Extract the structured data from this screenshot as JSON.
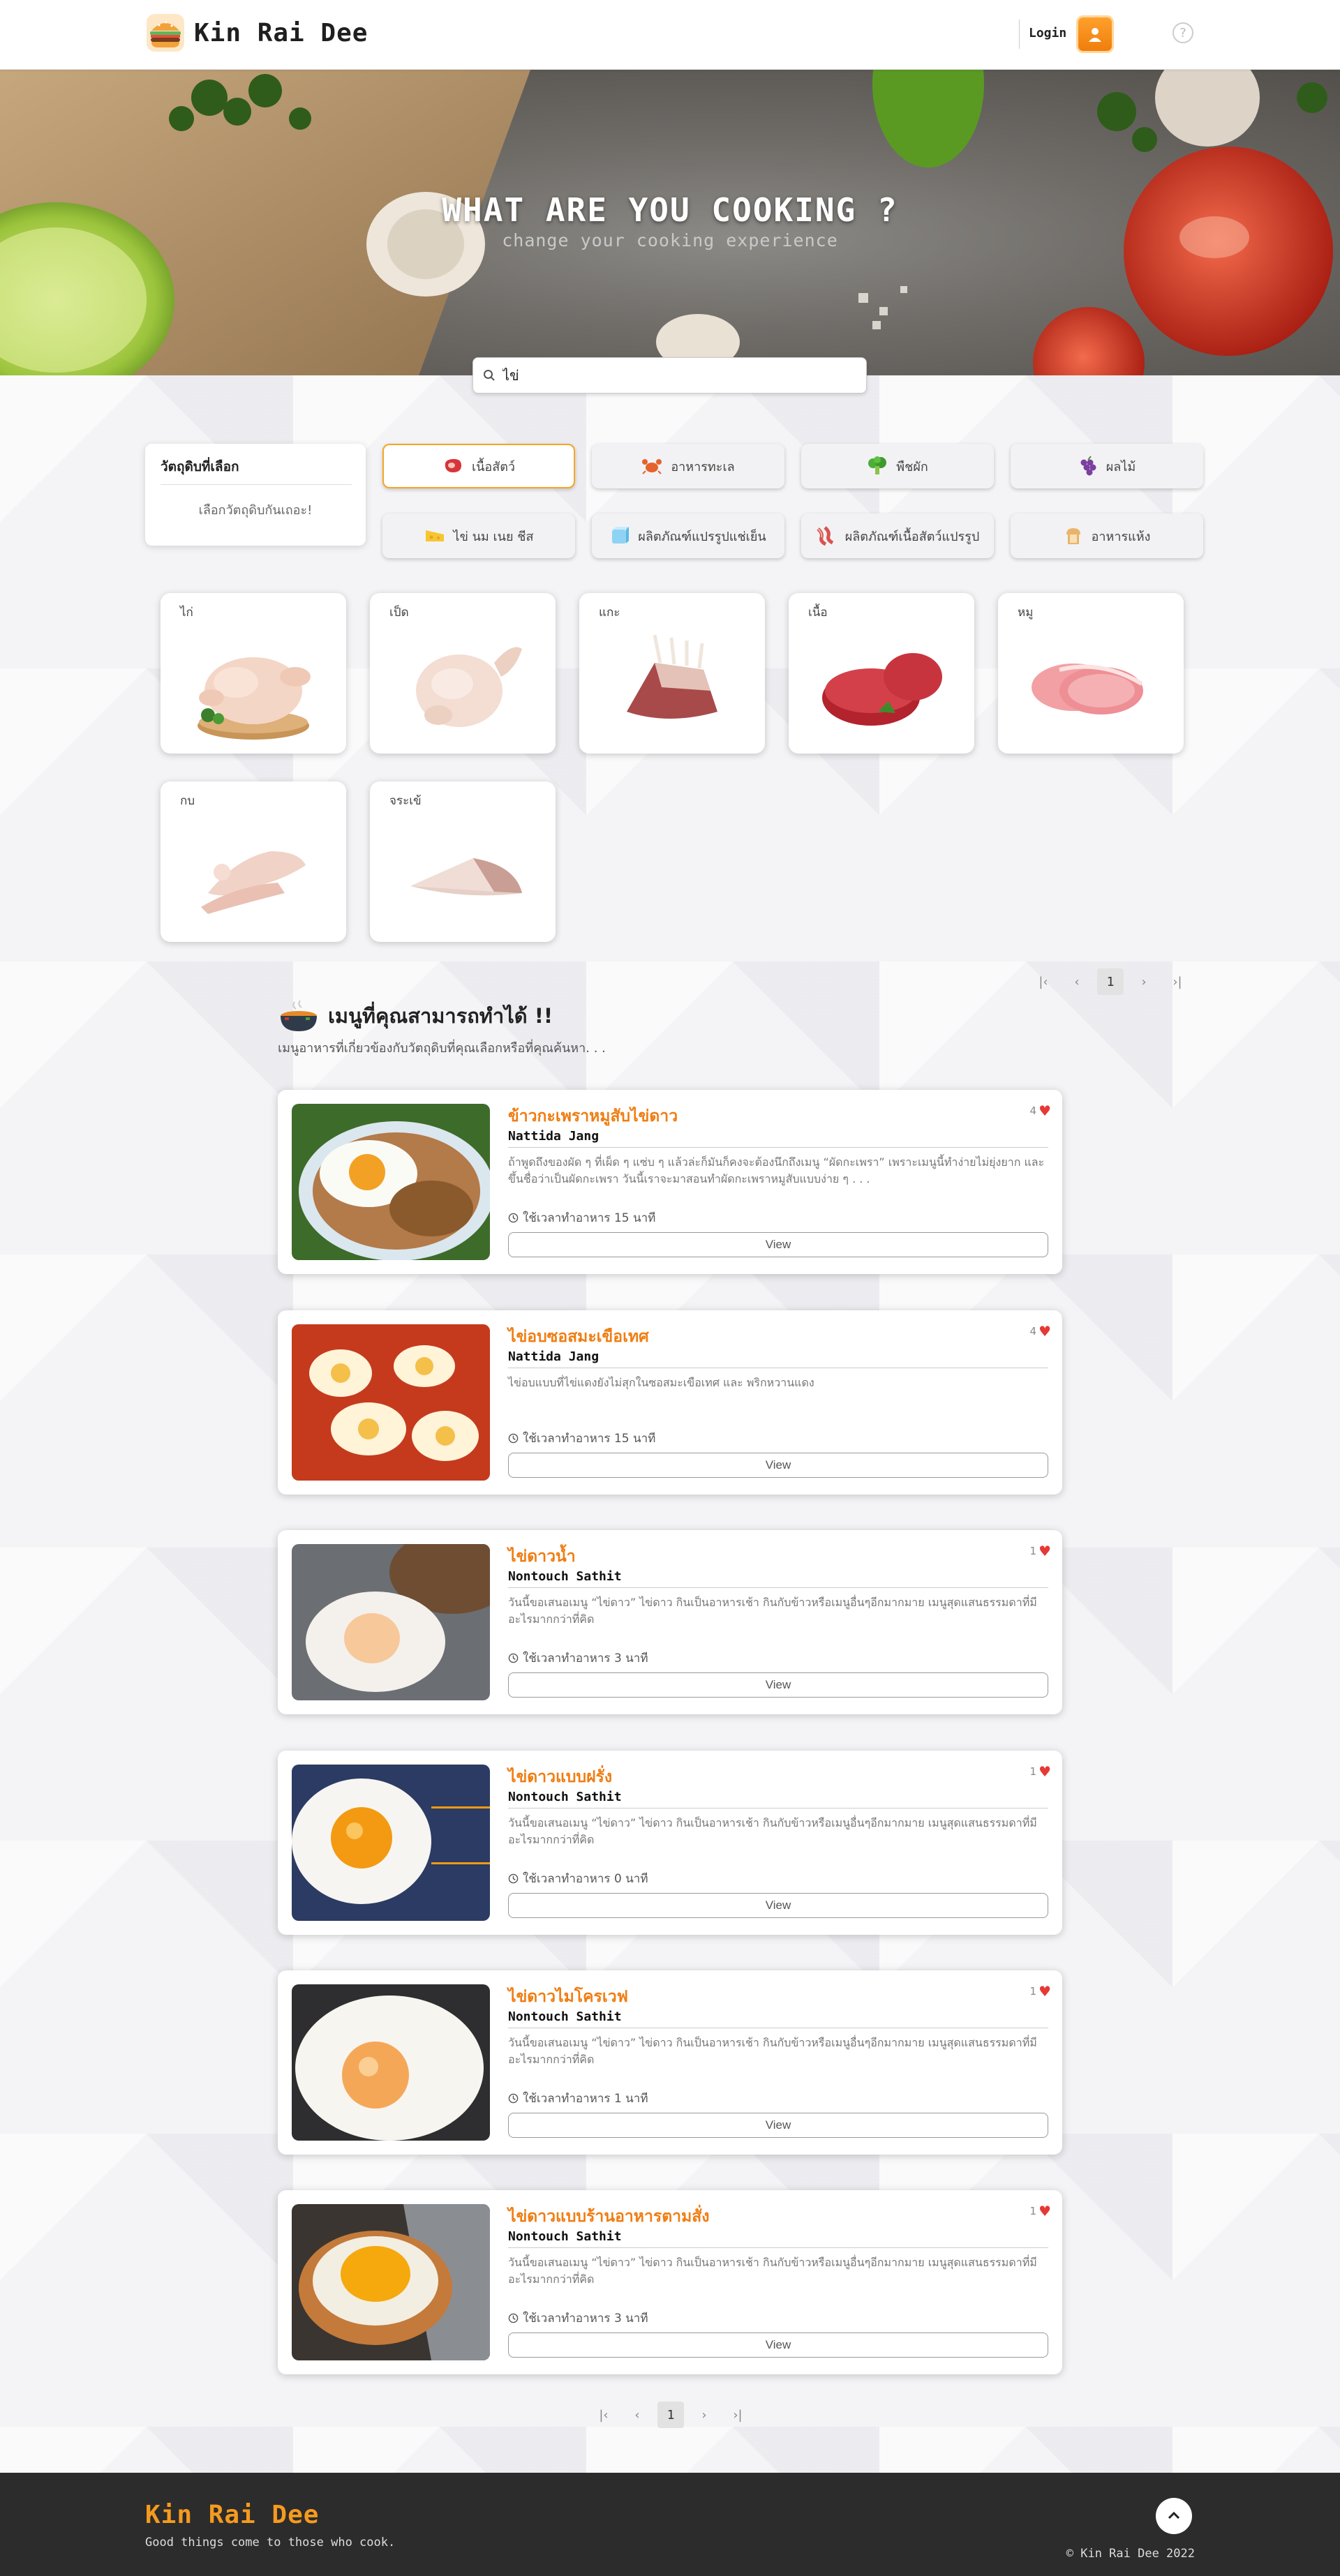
{
  "header": {
    "brand": "Kin Rai Dee",
    "login": "Login",
    "help_icon": "?"
  },
  "hero": {
    "title": "WHAT ARE YOU COOKING ?",
    "subtitle": "change your cooking experience",
    "search_value": "ไข่"
  },
  "selected": {
    "title": "วัตถุดิบที่เลือก",
    "hint": "เลือกวัตถุดิบกันเถอะ!"
  },
  "categories": [
    {
      "label": "เนื้อสัตว์",
      "icon": "meat-icon",
      "active": true
    },
    {
      "label": "อาหารทะเล",
      "icon": "crab-icon",
      "active": false
    },
    {
      "label": "พืชผัก",
      "icon": "broccoli-icon",
      "active": false
    },
    {
      "label": "ผลไม้",
      "icon": "grapes-icon",
      "active": false
    },
    {
      "label": "ไข่ นม เนย ชีส",
      "icon": "cheese-icon",
      "active": false
    },
    {
      "label": "ผลิตภัณฑ์แปรรูปแช่เย็น",
      "icon": "ice-cube-icon",
      "active": false
    },
    {
      "label": "ผลิตภัณฑ์เนื้อสัตว์แปรรูป",
      "icon": "bacon-icon",
      "active": false
    },
    {
      "label": "อาหารแห้ง",
      "icon": "bread-icon",
      "active": false
    }
  ],
  "ingredients": [
    {
      "label": "ไก่"
    },
    {
      "label": "เป็ด"
    },
    {
      "label": "แกะ"
    },
    {
      "label": "เนื้อ"
    },
    {
      "label": "หมู"
    },
    {
      "label": "กบ"
    },
    {
      "label": "จระเข้"
    }
  ],
  "pager": {
    "current": "1",
    "first": "|‹",
    "prev": "‹",
    "next": "›",
    "last": "›|"
  },
  "menu": {
    "heading": "เมนูที่คุณสามารถทำได้  !!",
    "sub": "เมนูอาหารที่เกี่ยวข้องกับวัตถุดิบที่คุณเลือกหรือที่คุณค้นหา. . ."
  },
  "recipes": [
    {
      "title": "ข้าวกะเพราหมูสับไข่ดาว",
      "author": "Nattida Jang",
      "desc": "ถ้าพูดถึงของผัด ๆ ที่เผ็ด ๆ แซ่บ ๆ แล้วล่ะก็มันก็คงจะต้องนึกถึงเมนู “ผัดกะเพรา” เพราะเมนูนี้ทำง่ายไม่ยุ่งยาก และขึ้นชื่อว่าเป็นผัดกะเพรา วันนี้เราจะมาสอนทำผัดกะเพราหมูสับแบบง่าย ๆ . . .",
      "time": "ใช้เวลาทำอาหาร 15 นาที",
      "likes": "4",
      "view": "View"
    },
    {
      "title": "ไข่อบซอสมะเขือเทศ",
      "author": "Nattida Jang",
      "desc": "ไข่อบแบบที่ไข่แดงยังไม่สุกในซอสมะเขือเทศ และ พริกหวานแดง",
      "time": "ใช้เวลาทำอาหาร 15 นาที",
      "likes": "4",
      "view": "View"
    },
    {
      "title": "ไข่ดาวน้ำ",
      "author": "Nontouch Sathit",
      "desc": "วันนี้ขอเสนอเมนู “ไข่ดาว” ไข่ดาว กินเป็นอาหารเช้า กินกับข้าวหรือเมนูอื่นๆอีกมากมาย เมนูสุดแสนธรรมดาที่มีอะไรมากกว่าที่คิด",
      "time": "ใช้เวลาทำอาหาร 3 นาที",
      "likes": "1",
      "view": "View"
    },
    {
      "title": "ไข่ดาวแบบฝรั่ง",
      "author": "Nontouch Sathit",
      "desc": "วันนี้ขอเสนอเมนู “ไข่ดาว” ไข่ดาว กินเป็นอาหารเช้า กินกับข้าวหรือเมนูอื่นๆอีกมากมาย เมนูสุดแสนธรรมดาที่มีอะไรมากกว่าที่คิด",
      "time": "ใช้เวลาทำอาหาร 0 นาที",
      "likes": "1",
      "view": "View"
    },
    {
      "title": "ไข่ดาวไมโครเวฟ",
      "author": "Nontouch Sathit",
      "desc": "วันนี้ขอเสนอเมนู “ไข่ดาว” ไข่ดาว กินเป็นอาหารเช้า กินกับข้าวหรือเมนูอื่นๆอีกมากมาย เมนูสุดแสนธรรมดาที่มีอะไรมากกว่าที่คิด",
      "time": "ใช้เวลาทำอาหาร 1 นาที",
      "likes": "1",
      "view": "View"
    },
    {
      "title": "ไข่ดาวแบบร้านอาหารตามสั่ง",
      "author": "Nontouch Sathit",
      "desc": "วันนี้ขอเสนอเมนู “ไข่ดาว” ไข่ดาว กินเป็นอาหารเช้า กินกับข้าวหรือเมนูอื่นๆอีกมากมาย เมนูสุดแสนธรรมดาที่มีอะไรมากกว่าที่คิด",
      "time": "ใช้เวลาทำอาหาร 3 นาที",
      "likes": "1",
      "view": "View"
    }
  ],
  "footer": {
    "brand": "Kin Rai Dee",
    "tagline": "Good things come to those who cook.",
    "copyright": "© Kin Rai Dee 2022"
  },
  "colors": {
    "accent": "#f07d12",
    "brand_orange": "#f59a1f",
    "heart": "#e53935",
    "footer_bg": "#2c2c2c"
  }
}
